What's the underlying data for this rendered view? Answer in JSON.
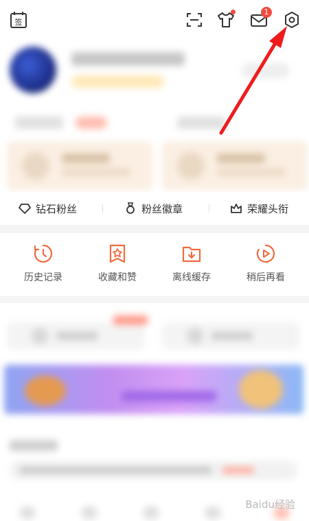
{
  "header": {
    "icons": [
      "calendar-sign-icon",
      "scan-icon",
      "tshirt-icon",
      "mail-icon",
      "settings-icon"
    ],
    "sign_label": "签",
    "mail_badge": "1"
  },
  "fans_row": {
    "items": [
      {
        "icon": "diamond-icon",
        "label": "钻石粉丝"
      },
      {
        "icon": "badge-icon",
        "label": "粉丝徽章"
      },
      {
        "icon": "crown-icon",
        "label": "荣耀头衔"
      }
    ]
  },
  "tools": [
    {
      "icon": "history-icon",
      "label": "历史记录"
    },
    {
      "icon": "favorite-icon",
      "label": "收藏和赞"
    },
    {
      "icon": "offline-cache-icon",
      "label": "离线缓存"
    },
    {
      "icon": "watch-later-icon",
      "label": "稍后再看"
    }
  ],
  "watermark": "Baidu经验",
  "colors": {
    "accent": "#f06a3e",
    "badge": "#f04a3e",
    "annotation_arrow": "#ee1c1c"
  }
}
